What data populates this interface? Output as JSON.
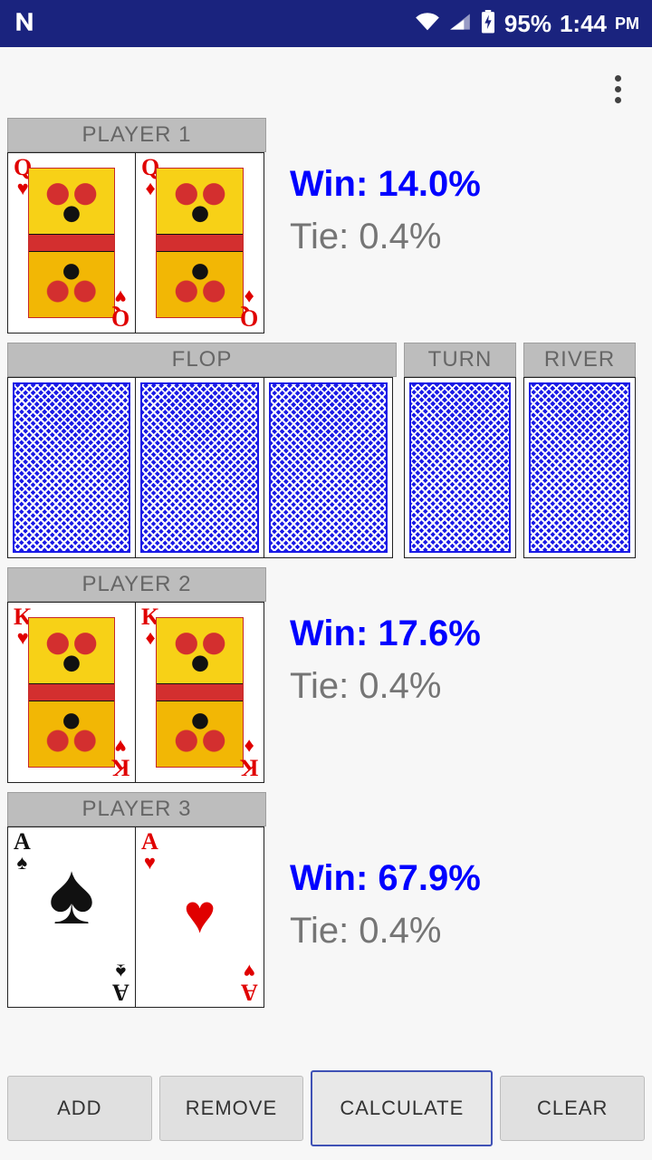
{
  "status_bar": {
    "left_icon": "nfc-n-icon",
    "wifi_icon": "wifi-icon",
    "signal_icon": "cell-signal-icon",
    "battery_icon": "battery-charging-icon",
    "battery_text": "95%",
    "time": "1:44",
    "ampm": "PM"
  },
  "app_bar": {
    "overflow_icon": "overflow-menu-icon"
  },
  "players": [
    {
      "label": "PLAYER 1",
      "cards": [
        {
          "rank": "Q",
          "suit": "♥",
          "color": "red",
          "type": "face"
        },
        {
          "rank": "Q",
          "suit": "♦",
          "color": "red",
          "type": "face"
        }
      ],
      "win_label": "Win: 14.0%",
      "tie_label": "Tie: 0.4%"
    },
    {
      "label": "PLAYER 2",
      "cards": [
        {
          "rank": "K",
          "suit": "♥",
          "color": "red",
          "type": "face"
        },
        {
          "rank": "K",
          "suit": "♦",
          "color": "red",
          "type": "face"
        }
      ],
      "win_label": "Win: 17.6%",
      "tie_label": "Tie: 0.4%"
    },
    {
      "label": "PLAYER 3",
      "cards": [
        {
          "rank": "A",
          "suit": "♠",
          "color": "black",
          "type": "ace"
        },
        {
          "rank": "A",
          "suit": "♥",
          "color": "red",
          "type": "ace"
        }
      ],
      "win_label": "Win: 67.9%",
      "tie_label": "Tie: 0.4%"
    }
  ],
  "board": {
    "flop": {
      "label": "FLOP",
      "cards": [
        "card-back",
        "card-back",
        "card-back"
      ]
    },
    "turn": {
      "label": "TURN",
      "cards": [
        "card-back"
      ]
    },
    "river": {
      "label": "RIVER",
      "cards": [
        "card-back"
      ]
    }
  },
  "buttons": {
    "add": "ADD",
    "remove": "REMOVE",
    "calculate": "CALCULATE",
    "clear": "CLEAR"
  },
  "colors": {
    "status_bar": "#1a237e",
    "win_text": "#0000ff",
    "tie_text": "#757575",
    "label_bar": "#bdbdbd",
    "card_back": "#1a1ae6",
    "accent": "#3f51b5"
  }
}
